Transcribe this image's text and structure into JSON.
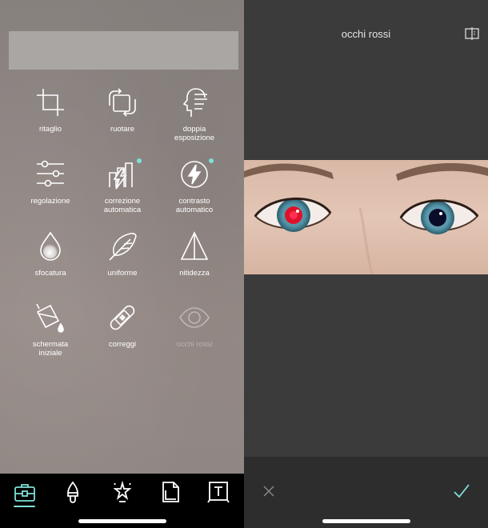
{
  "tools": [
    {
      "label": "ritaglio",
      "icon": "crop-icon"
    },
    {
      "label": "ruotare",
      "icon": "rotate-icon"
    },
    {
      "label": "doppia\nesposizione",
      "icon": "double-exposure-icon"
    },
    {
      "label": "regolazione",
      "icon": "sliders-icon"
    },
    {
      "label": "correzione\nautomatica",
      "icon": "auto-correct-icon",
      "new": true
    },
    {
      "label": "contrasto\nautomatico",
      "icon": "auto-contrast-icon",
      "new": true
    },
    {
      "label": "sfocatura",
      "icon": "blur-drop-icon"
    },
    {
      "label": "uniforme",
      "icon": "feather-icon"
    },
    {
      "label": "nitidezza",
      "icon": "sharpen-triangle-icon"
    },
    {
      "label": "schermata\niniziale",
      "icon": "paint-bucket-icon"
    },
    {
      "label": "correggi",
      "icon": "bandage-icon"
    },
    {
      "label": "occhi rossi",
      "icon": "eye-icon",
      "disabled": true
    }
  ],
  "tabbar": {
    "items": [
      "toolbox-icon",
      "brush-icon",
      "magic-stars-icon",
      "document-icon",
      "text-frame-icon"
    ],
    "active_index": 0
  },
  "editor": {
    "title": "occhi rossi"
  },
  "colors": {
    "accent": "#7fe0d8",
    "right_bg": "#3b3b3b",
    "bottom_bar": "#2d2d2d"
  }
}
